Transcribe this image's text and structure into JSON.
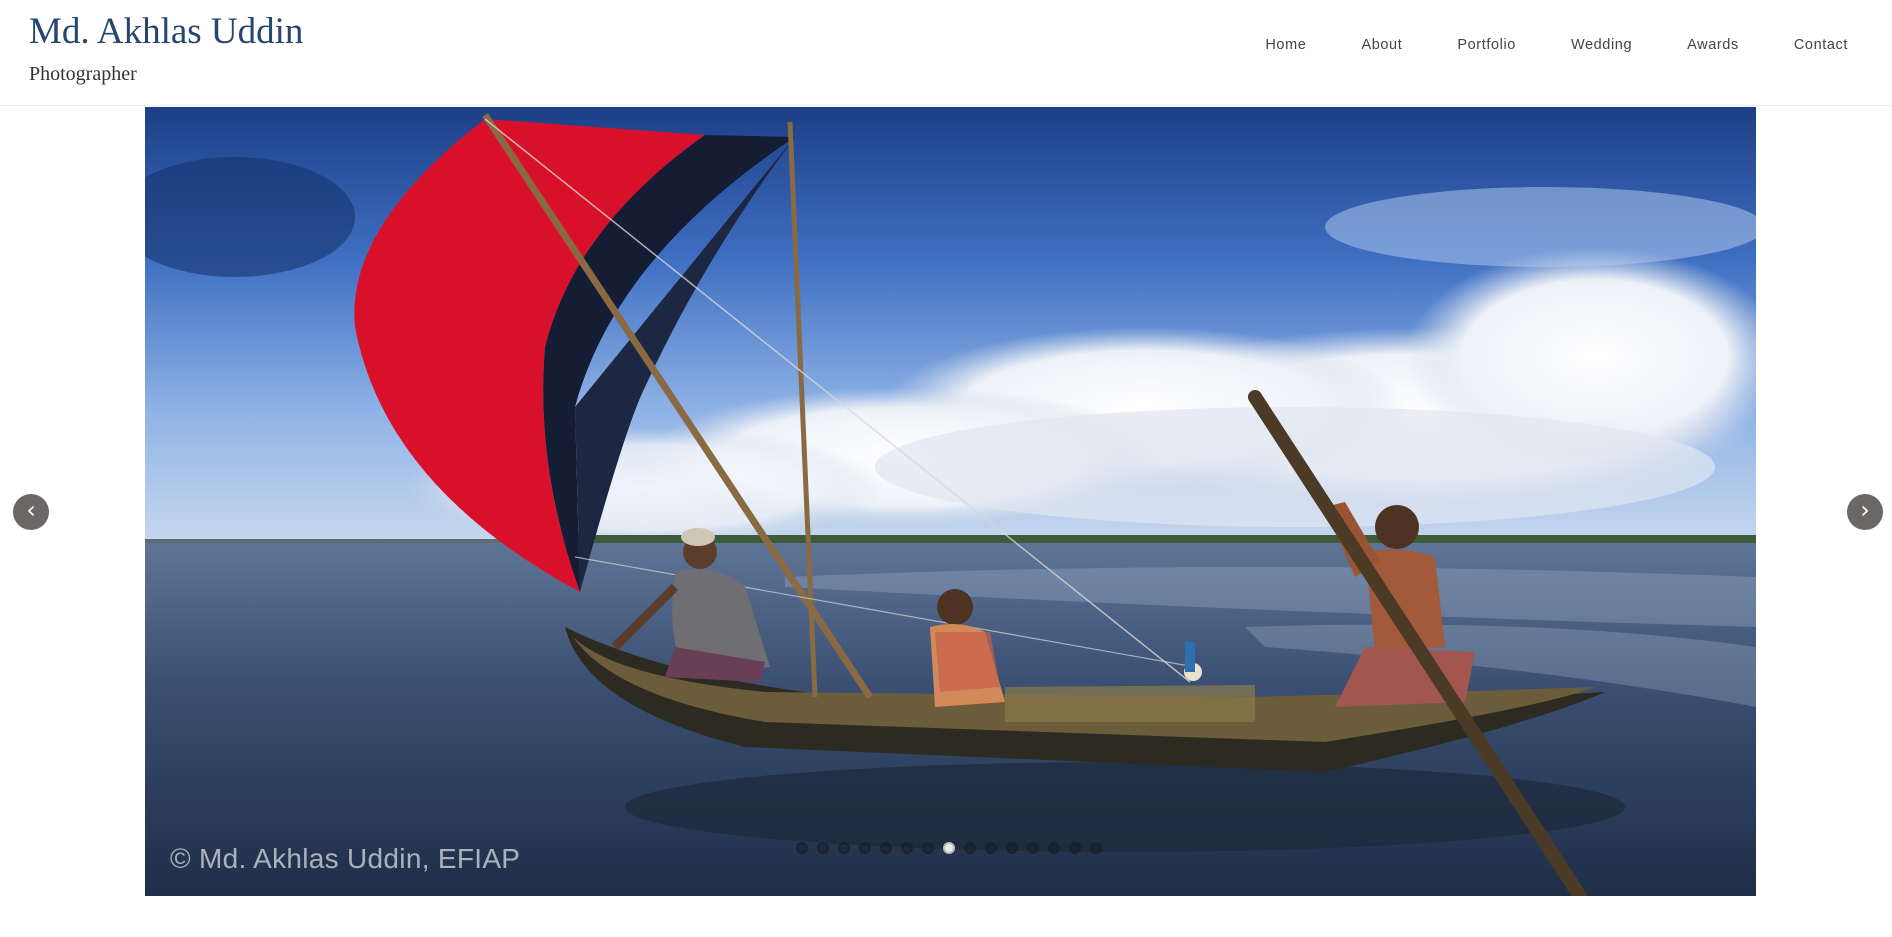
{
  "header": {
    "title": "Md. Akhlas Uddin",
    "subtitle": "Photographer"
  },
  "nav": {
    "items": [
      {
        "label": "Home"
      },
      {
        "label": "About"
      },
      {
        "label": "Portfolio"
      },
      {
        "label": "Wedding"
      },
      {
        "label": "Awards"
      },
      {
        "label": "Contact"
      }
    ]
  },
  "slider": {
    "prev_symbol": "‹",
    "next_symbol": "›",
    "watermark": "© Md. Akhlas Uddin, EFIAP",
    "slide_count": 15,
    "active_slide": 8
  },
  "colors": {
    "title": "#24466f",
    "arrow_bg": "#6b6767"
  }
}
